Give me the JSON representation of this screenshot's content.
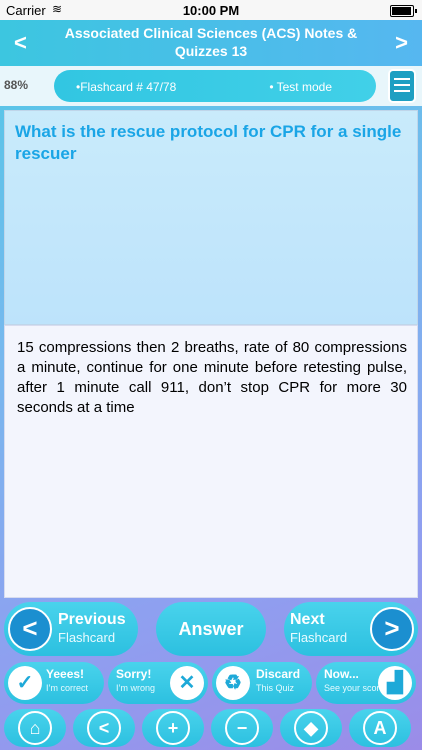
{
  "status_bar": {
    "carrier": "Carrier",
    "time": "10:00 PM"
  },
  "header": {
    "title": "Associated Clinical Sciences (ACS) Notes & Quizzes 13",
    "prev_icon": "chevron-left-icon",
    "next_icon": "chevron-right-icon"
  },
  "progress": {
    "percent": "88%",
    "flashcard": "•Flashcard #  47/78",
    "mode": "• Test mode"
  },
  "question": {
    "text": "What is the rescue protocol for CPR for a single rescuer"
  },
  "answer": {
    "text": "15 compressions then 2 breaths, rate of 80 compressions a minute, continue for one minute before retesting pulse, after 1 minute call 911, don’t stop CPR for more 30 seconds at a time"
  },
  "controls": {
    "previous_big": "Previous",
    "previous_small": "Flashcard",
    "answer": "Answer",
    "next_big": "Next",
    "next_small": "Flashcard"
  },
  "actions": {
    "yes_title": "Yeees!",
    "yes_sub": "I’m correct",
    "sorry_title": "Sorry!",
    "sorry_sub": "I’m wrong",
    "discard_title": "Discard",
    "discard_sub": "This Quiz",
    "now_title": "Now...",
    "now_sub": "See your score"
  },
  "toolbar": {
    "icons": [
      "home-icon",
      "share-icon",
      "zoom-in-icon",
      "zoom-out-icon",
      "paint-bucket-icon",
      "font-icon"
    ]
  },
  "colors": {
    "accent": "#2cc0e0",
    "question_text": "#1aa5e6",
    "circle_blue": "#1b8fd0"
  }
}
